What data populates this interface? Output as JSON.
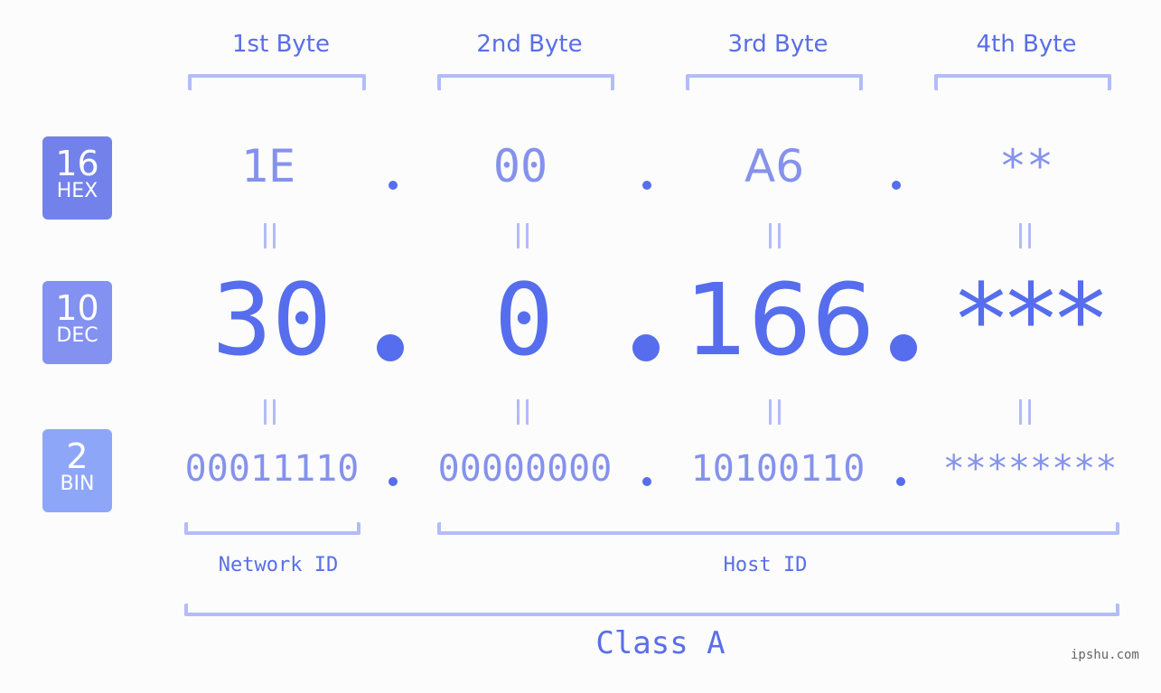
{
  "byte_headers": [
    "1st Byte",
    "2nd Byte",
    "3rd Byte",
    "4th Byte"
  ],
  "bases": [
    {
      "number": "16",
      "label": "HEX",
      "color": "#7382ea"
    },
    {
      "number": "10",
      "label": "DEC",
      "color": "#8391f0"
    },
    {
      "number": "2",
      "label": "BIN",
      "color": "#8ea6f8"
    }
  ],
  "hex": [
    "1E",
    "00",
    "A6",
    "**"
  ],
  "dec": [
    "30",
    "0",
    "166",
    "***"
  ],
  "bin": [
    "00011110",
    "00000000",
    "10100110",
    "********"
  ],
  "separator": ".",
  "network_id_label": "Network ID",
  "host_id_label": "Host ID",
  "class_label": "Class A",
  "watermark": "ipshu.com",
  "colors": {
    "accent": "#566ded",
    "bracket": "#b3bcf6",
    "light_text": "#8592ec",
    "background": "#fbfcfb"
  }
}
